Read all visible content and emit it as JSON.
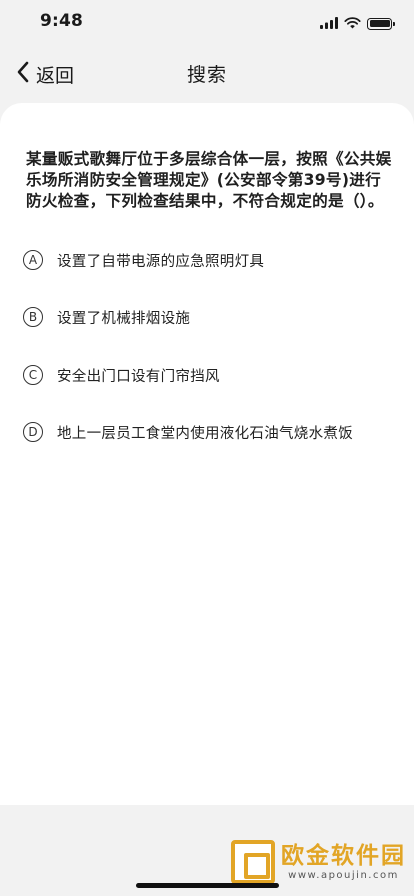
{
  "status_bar": {
    "time": "9:48"
  },
  "nav": {
    "back_label": "返回",
    "title": "搜索"
  },
  "question": {
    "text": "某量贩式歌舞厅位于多层综合体一层，按照《公共娱乐场所消防安全管理规定》(公安部令第39号)进行防火检查，下列检查结果中，不符合规定的是（）。"
  },
  "options": [
    {
      "letter": "A",
      "text": "设置了自带电源的应急照明灯具"
    },
    {
      "letter": "B",
      "text": "设置了机械排烟设施"
    },
    {
      "letter": "C",
      "text": "安全出门口设有门帘挡风"
    },
    {
      "letter": "D",
      "text": "地上一层员工食堂内使用液化石油气烧水煮饭"
    }
  ],
  "watermark": {
    "title": "欧金软件园",
    "url": "www.apoujin.com"
  },
  "colors": {
    "background": "#f2f2f2",
    "card": "#ffffff",
    "watermark": "#e2a526"
  }
}
